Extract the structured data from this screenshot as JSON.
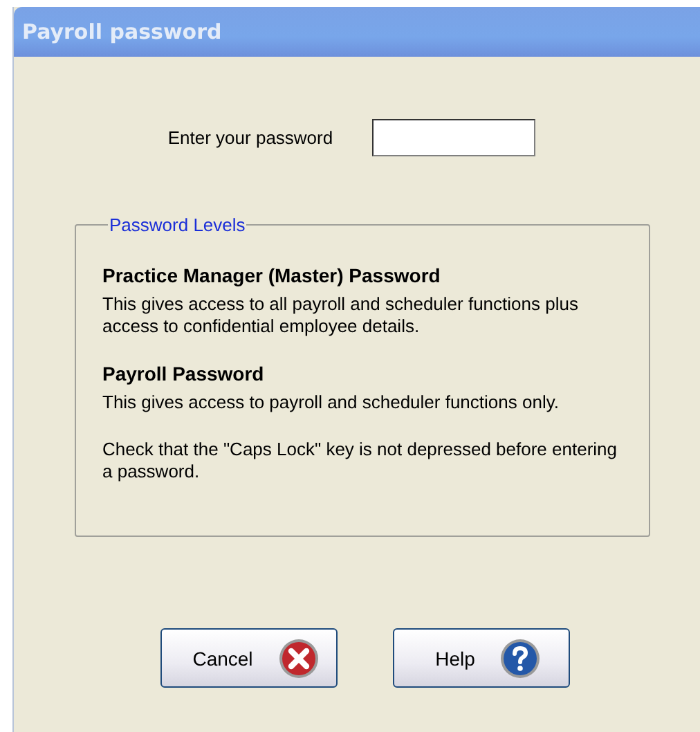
{
  "window": {
    "title": "Payroll password"
  },
  "password_field": {
    "label": "Enter your password"
  },
  "group": {
    "title": "Password Levels",
    "sections": [
      {
        "heading": "Practice Manager (Master) Password",
        "text": "This gives access to all payroll and scheduler functions plus access to confidential employee details."
      },
      {
        "heading": "Payroll Password",
        "text": "This gives access to payroll and scheduler functions only."
      },
      {
        "text": "Check that the \"Caps Lock\" key is not depressed before entering a password."
      }
    ]
  },
  "buttons": [
    {
      "label": "Cancel",
      "kind": "cancel"
    },
    {
      "label": "Help",
      "kind": "help"
    }
  ]
}
